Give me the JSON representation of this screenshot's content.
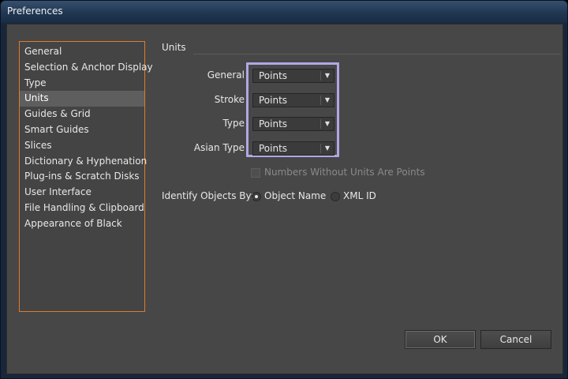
{
  "window": {
    "title": "Preferences"
  },
  "sidebar": {
    "items": [
      {
        "label": "General"
      },
      {
        "label": "Selection & Anchor Display"
      },
      {
        "label": "Type"
      },
      {
        "label": "Units",
        "selected": true
      },
      {
        "label": "Guides & Grid"
      },
      {
        "label": "Smart Guides"
      },
      {
        "label": "Slices"
      },
      {
        "label": "Dictionary & Hyphenation"
      },
      {
        "label": "Plug-ins & Scratch Disks"
      },
      {
        "label": "User Interface"
      },
      {
        "label": "File Handling & Clipboard"
      },
      {
        "label": "Appearance of Black"
      }
    ]
  },
  "units": {
    "section_title": "Units",
    "rows": [
      {
        "label": "General",
        "value": "Points"
      },
      {
        "label": "Stroke",
        "value": "Points"
      },
      {
        "label": "Type",
        "value": "Points"
      },
      {
        "label": "Asian Type",
        "value": "Points"
      }
    ],
    "numbers_without_units": {
      "label": "Numbers Without Units Are Points",
      "checked": false,
      "enabled": false
    }
  },
  "identify": {
    "label": "Identify Objects By:",
    "options": [
      {
        "label": "Object Name",
        "selected": true
      },
      {
        "label": "XML ID",
        "selected": false
      }
    ]
  },
  "buttons": {
    "ok": "OK",
    "cancel": "Cancel"
  },
  "icons": {
    "dropdown": "chevron-down-icon",
    "radio": "radio-dot-icon"
  },
  "colors": {
    "accent_focus": "#b3a6e6",
    "sidebar_border": "#e07b2a",
    "panel_bg": "#474747"
  }
}
